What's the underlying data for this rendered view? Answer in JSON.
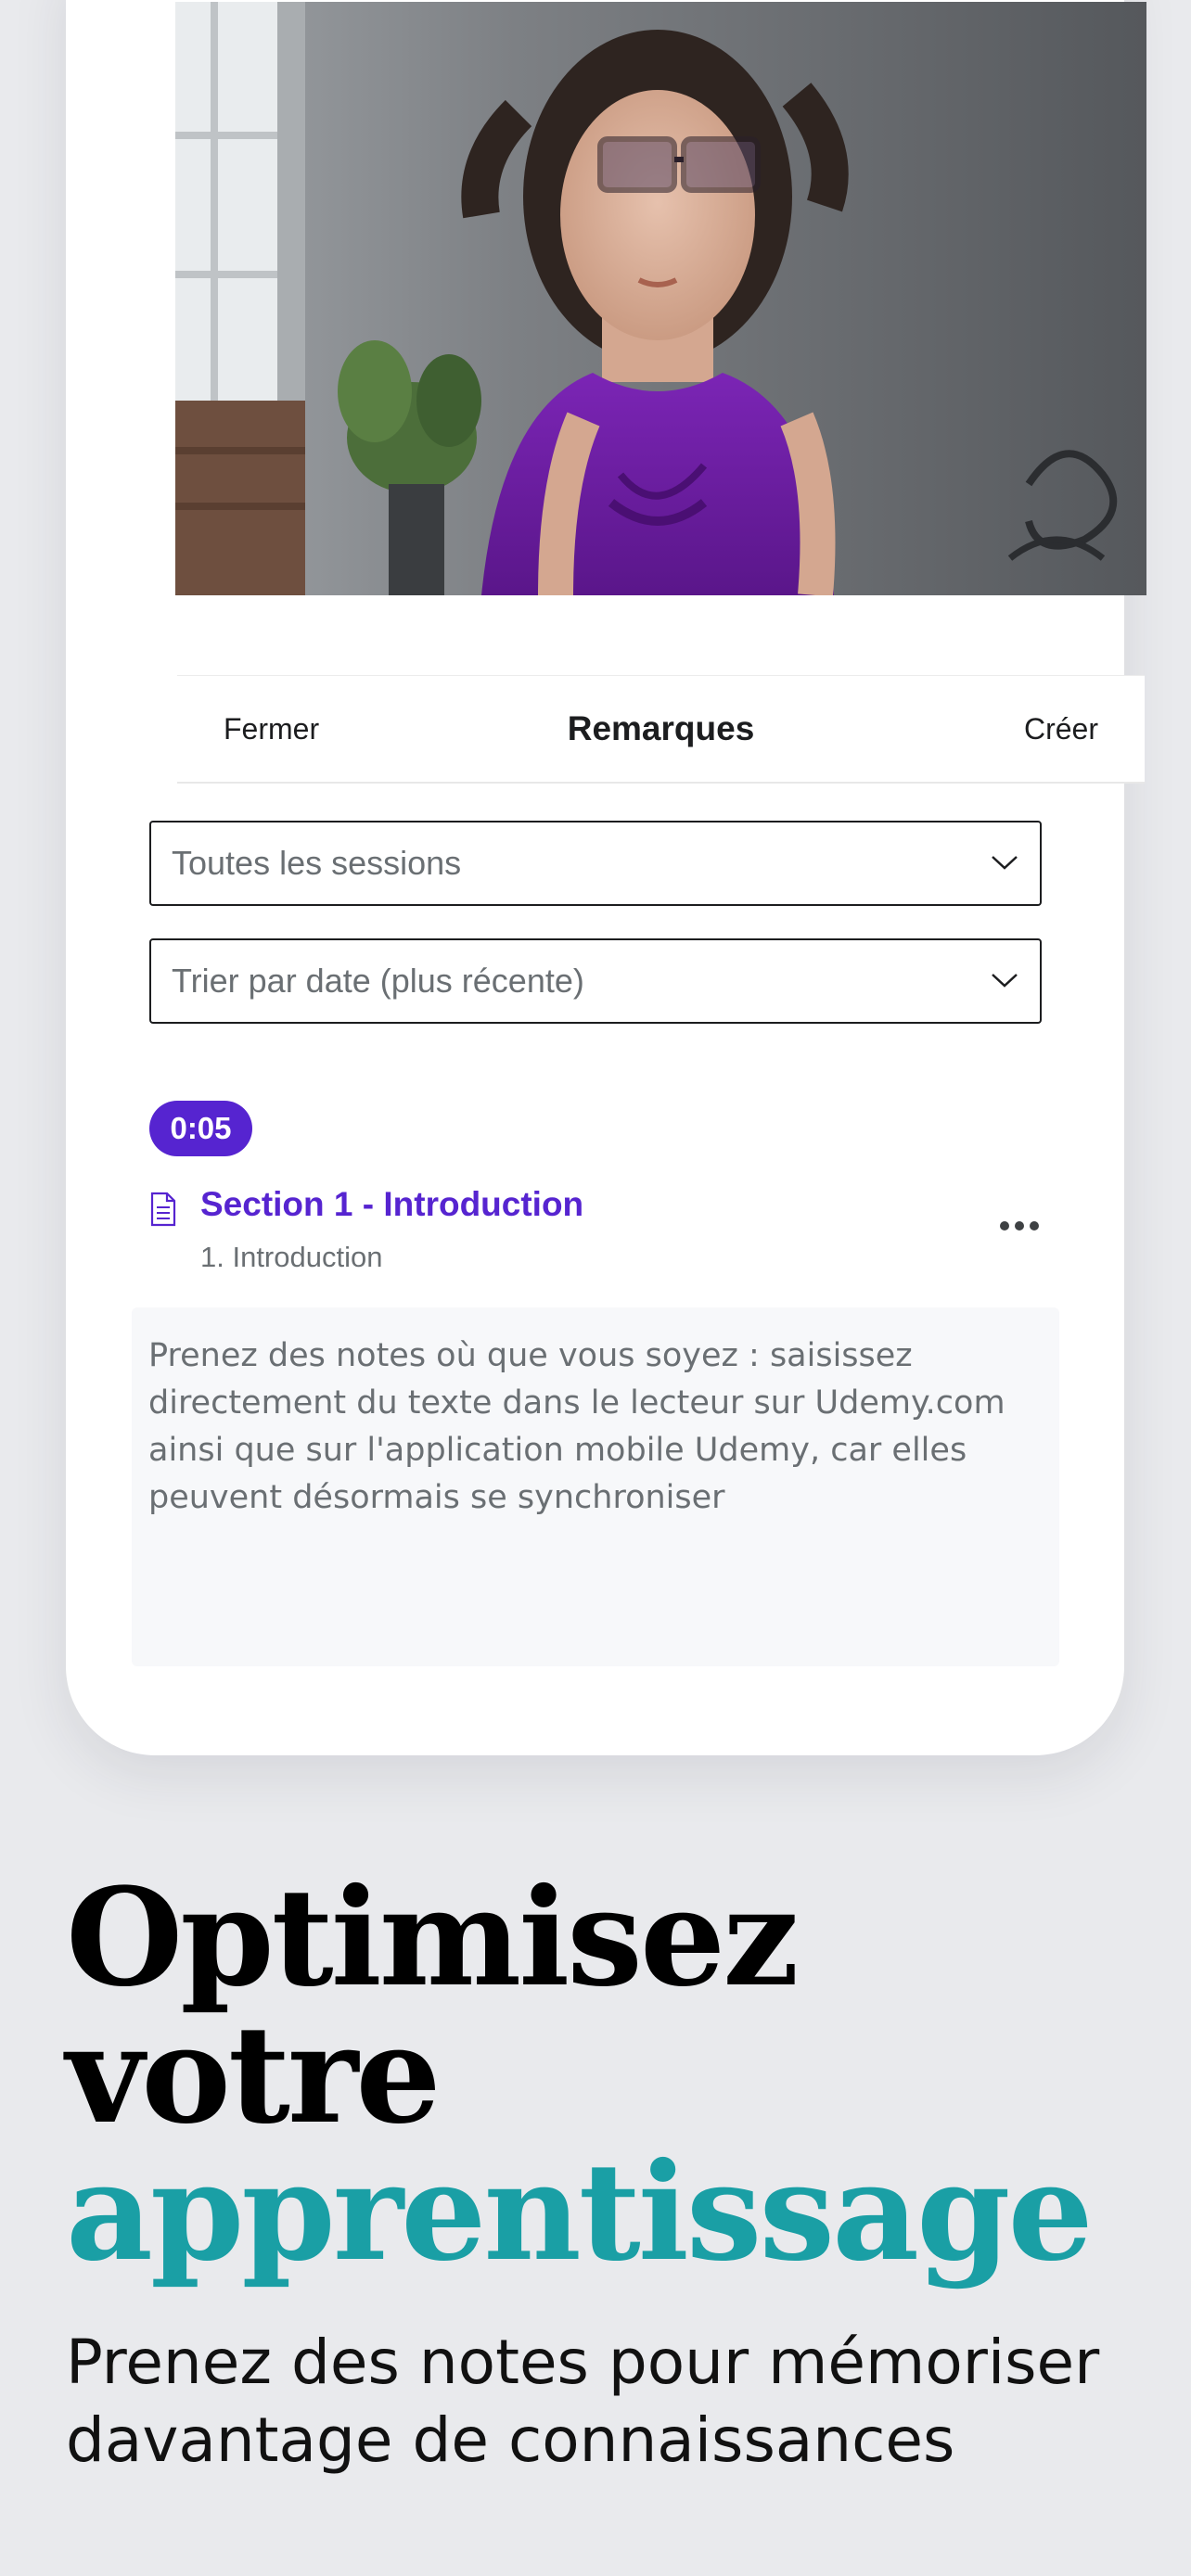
{
  "navigation": {
    "close_label": "Fermer",
    "title": "Remarques",
    "create_label": "Créer"
  },
  "filters": {
    "session_select": "Toutes les sessions",
    "sort_select": "Trier par date (plus récente)"
  },
  "note": {
    "timestamp": "0:05",
    "section_title": "Section 1 - Introduction",
    "lecture_title": "1. Introduction",
    "body": "Prenez des notes où que vous soyez : saisissez directement du texte dans le lecteur sur Udemy.com ainsi que sur l'application mobile Udemy, car elles peuvent désormais se synchroniser"
  },
  "promo": {
    "headline_line1": "Optimisez",
    "headline_line2": "votre",
    "headline_line3": "apprentissage",
    "subheadline": "Prenez des notes pour mémoriser davantage de connaissances"
  },
  "icons": {
    "chevron": "chevron-down-icon",
    "document": "document-icon",
    "more": "more-options-icon"
  },
  "colors": {
    "accent_purple": "#5624d0",
    "accent_teal": "#1a9fa5",
    "background": "#e9eaed"
  }
}
